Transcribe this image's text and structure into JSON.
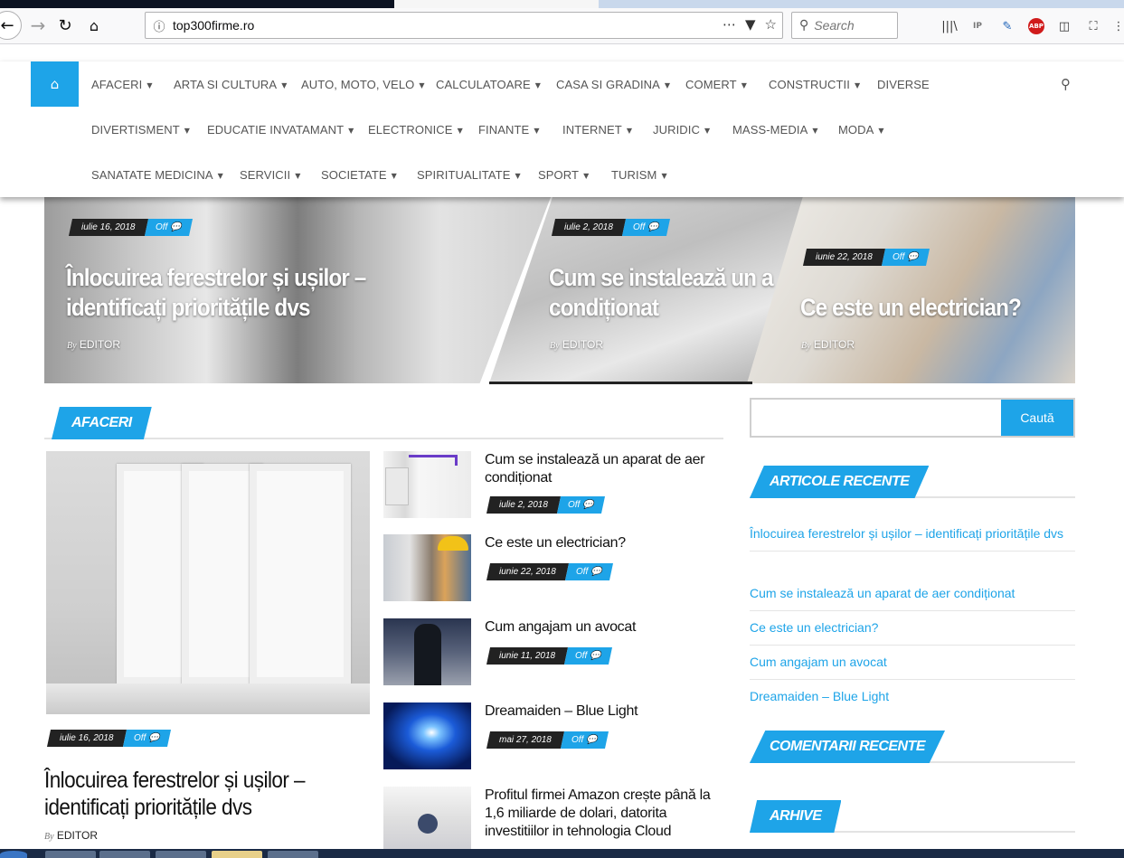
{
  "browser": {
    "url": "top300firme.ro",
    "search_placeholder": "Search"
  },
  "colors": {
    "accent": "#1ea4e8",
    "dark": "#222222",
    "link": "#1ea4e8"
  },
  "nav": {
    "row1": [
      "AFACERI",
      "ARTA SI CULTURA",
      "AUTO, MOTO, VELO",
      "CALCULATOARE",
      "CASA SI GRADINA",
      "COMERT",
      "CONSTRUCTII",
      "DIVERSE"
    ],
    "row2": [
      "DIVERTISMENT",
      "EDUCATIE INVATAMANT",
      "ELECTRONICE",
      "FINANTE",
      "INTERNET",
      "JURIDIC",
      "MASS-MEDIA",
      "MODA"
    ],
    "row3": [
      "SANATATE MEDICINA",
      "SERVICII",
      "SOCIETATE",
      "SPIRITUALITATE",
      "SPORT",
      "TURISM"
    ]
  },
  "hero": [
    {
      "date": "iulie 16, 2018",
      "comments": "Off",
      "title1": "Înlocuirea ferestrelor și ușilor –",
      "title2": "identificați prioritățile dvs",
      "by": "By",
      "author": "EDITOR"
    },
    {
      "date": "iulie 2, 2018",
      "comments": "Off",
      "title1": "Cum se instalează un a",
      "title2": "condiționat",
      "by": "By",
      "author": "EDITOR"
    },
    {
      "date": "iunie 22, 2018",
      "comments": "Off",
      "title1": "Ce este un electrician?",
      "title2": "",
      "by": "By",
      "author": "EDITOR"
    }
  ],
  "section": {
    "title": "AFACERI",
    "featured": {
      "date": "iulie 16, 2018",
      "comments": "Off",
      "title1": "Înlocuirea ferestrelor și ușilor –",
      "title2": "identificați prioritățile dvs",
      "by": "By",
      "author": "EDITOR"
    },
    "items": [
      {
        "title": "Cum se instalează un aparat de aer condiționat",
        "date": "iulie 2, 2018",
        "comments": "Off"
      },
      {
        "title": "Ce este un electrician?",
        "date": "iunie 22, 2018",
        "comments": "Off"
      },
      {
        "title": "Cum angajam un avocat",
        "date": "iunie 11, 2018",
        "comments": "Off"
      },
      {
        "title": "Dreamaiden – Blue Light",
        "date": "mai 27, 2018",
        "comments": "Off"
      },
      {
        "title": "Profitul firmei Amazon crește până la 1,6 miliarde de dolari, datorita investitiilor in tehnologia Cloud"
      }
    ]
  },
  "sidebar": {
    "search_button": "Caută",
    "recent_title": "ARTICOLE RECENTE",
    "recent": [
      "Înlocuirea ferestrelor și ușilor – identificați prioritățile dvs",
      "Cum se instalează un aparat de aer condiționat",
      "Ce este un electrician?",
      "Cum angajam un avocat",
      "Dreamaiden – Blue Light"
    ],
    "comments_title": "COMENTARII RECENTE",
    "archive_title": "ARHIVE"
  }
}
